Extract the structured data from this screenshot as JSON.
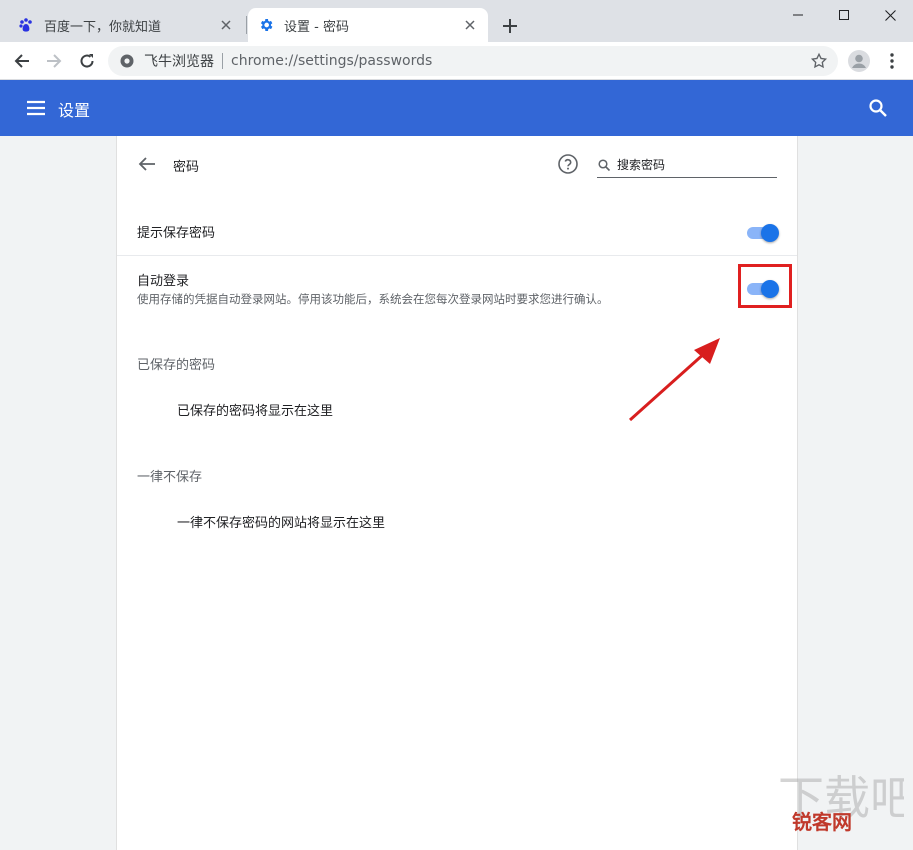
{
  "tabs": [
    {
      "title": "百度一下，你就知道",
      "icon": "baidu-paw-icon",
      "active": false
    },
    {
      "title": "设置 - 密码",
      "icon": "gear-icon",
      "active": true
    }
  ],
  "toolbar": {
    "site_name": "飞牛浏览器",
    "url": "chrome://settings/passwords"
  },
  "header": {
    "title": "设置"
  },
  "passwords_page": {
    "title": "密码",
    "search_placeholder": "搜索密码",
    "offer_to_save_label": "提示保存密码",
    "offer_to_save_enabled": true,
    "auto_signin_label": "自动登录",
    "auto_signin_desc": "使用存储的凭据自动登录网站。停用该功能后，系统会在您每次登录网站时要求您进行确认。",
    "auto_signin_enabled": true,
    "saved_section_title": "已保存的密码",
    "saved_empty_msg": "已保存的密码将显示在这里",
    "never_section_title": "一律不保存",
    "never_empty_msg": "一律不保存密码的网站将显示在这里"
  },
  "colors": {
    "header_blue": "#3367d6",
    "toggle_on": "#1a73e8",
    "annotation_red": "#e02020"
  },
  "watermark": {
    "text_small": "锐客网"
  }
}
